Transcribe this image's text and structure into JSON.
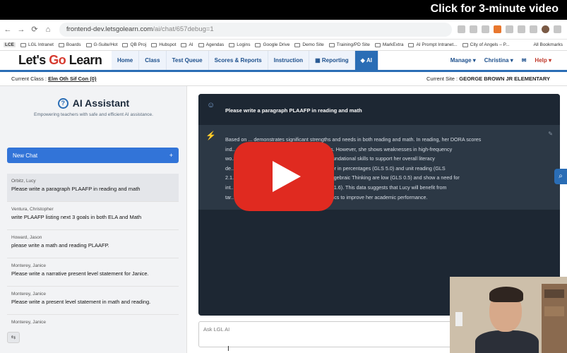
{
  "overlay": {
    "video_link": "Click for 3-minute video"
  },
  "browser": {
    "url_prefix": "frontend-dev.letsgolearn.com",
    "url_path": "/ai/chat/657debug=1",
    "bookmarks": [
      "LCE",
      "LGL Intranet",
      "Boards",
      "G-Suite/Hot",
      "QB Proj",
      "Hubspot",
      "AI",
      "Agendas",
      "Logins",
      "Google Drive",
      "Demo Site",
      "Training/PD Site",
      "MarkExtra",
      "AI Prompt Intranet...",
      "City of Angels – P..."
    ],
    "all_bookmarks": "All Bookmarks"
  },
  "app": {
    "logo_part1": "Let's ",
    "logo_part2": "Go",
    "logo_part3": " Learn",
    "menu": [
      "Home",
      "Class",
      "Test Queue",
      "Scores & Reports",
      "Instruction",
      "Reporting",
      "AI"
    ],
    "active_menu_index": 6,
    "right_menu": [
      "Manage ▾",
      "Christina ▾",
      "Help ▾"
    ]
  },
  "class_bar": {
    "label": "Current Class : ",
    "class_name": "Elm Oth Sif Con (0)",
    "site_label": "Current Site : ",
    "site_name": "GEORGE BROWN JR ELEMENTARY"
  },
  "sidebar": {
    "title": "AI Assistant",
    "subtitle": "Empowering teachers with safe and efficient AI assistance.",
    "new_chat": "New Chat",
    "chats": [
      {
        "who": "Orbitz, Lucy",
        "msg": "Please write a paragraph PLAAFP in reading and math"
      },
      {
        "who": "Ventura, Christopher",
        "msg": "write PLAAFP listing next 3 goals in both ELA and Math"
      },
      {
        "who": "Howard, Jason",
        "msg": "please write a math and reading PLAAFP."
      },
      {
        "who": "Monterey, Janice",
        "msg": "Please write a narrative present level statement for Janice."
      },
      {
        "who": "Monterey, Janice",
        "msg": "Please write a present level statement in math and reading."
      },
      {
        "who": "Monterey, Janice",
        "msg": ""
      }
    ]
  },
  "chat": {
    "user_prompt": "Please write a paragraph PLAAFP in reading and math",
    "ai_lines": [
      "Based on ... demonstrates significant strengths and needs in both reading and math. In reading, her DORA scores",
      "ind... ), commonly recognizing a variety of terms. However, she shows weaknesses in high-frequency",
      "wo... d phonics (GLS 0), indicating a need for foundational skills to support her overall literacy",
      "de... s that she has concurrently performed better in percentages (GLS 5.0) and unit reading (GLS",
      "2.1... pecifically, her grades in Operations and Algebraic Thinking are low (GLS 0.5) and show a need for",
      "int... dering (0) and Addition of Whole Numbers (1.6). This data suggests that Lucy will benefit from",
      "tar... mental skills in both reading and mathematics to improve her academic performance."
    ],
    "input_placeholder": "Ask LGL AI"
  }
}
